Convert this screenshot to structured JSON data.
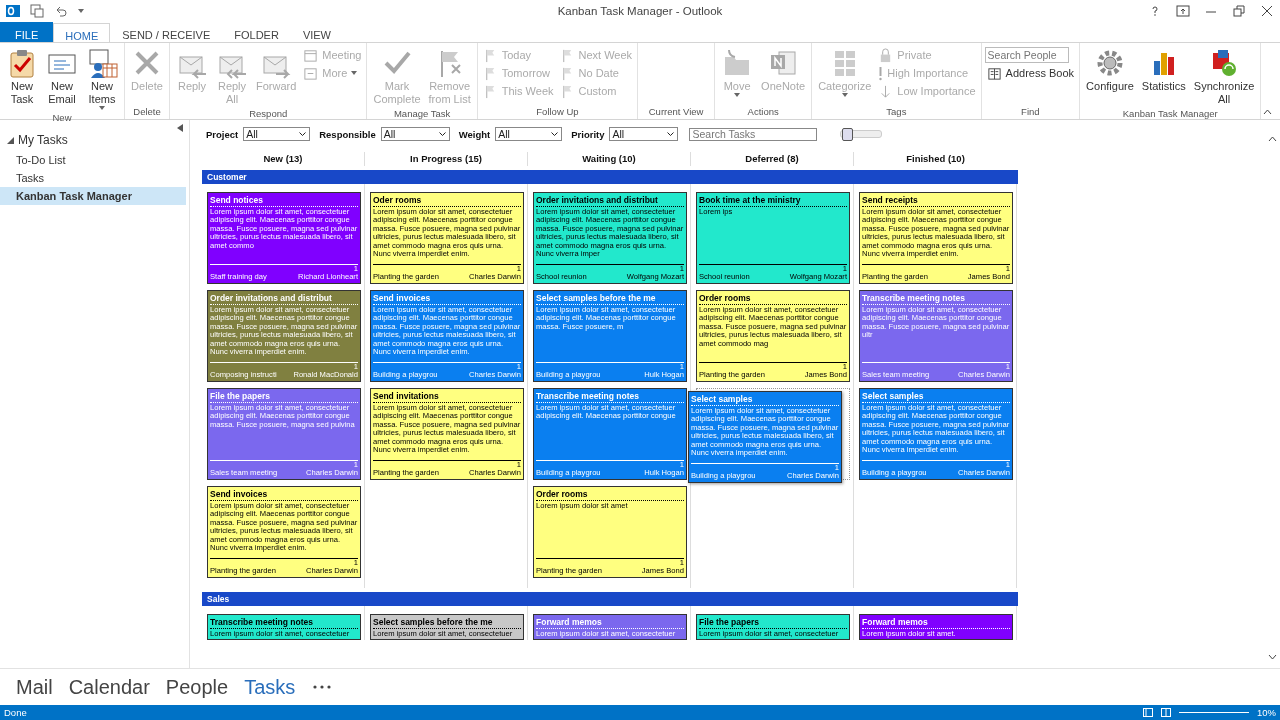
{
  "window": {
    "title": "Kanban Task Manager - Outlook"
  },
  "tabs": [
    {
      "label": "FILE",
      "kind": "file",
      "selected": false
    },
    {
      "label": "HOME",
      "kind": "tab",
      "selected": true
    },
    {
      "label": "SEND / RECEIVE",
      "kind": "tab",
      "selected": false
    },
    {
      "label": "FOLDER",
      "kind": "tab",
      "selected": false
    },
    {
      "label": "VIEW",
      "kind": "tab",
      "selected": false
    }
  ],
  "ribbon": [
    {
      "name": "New",
      "items": [
        {
          "label": "New\nTask",
          "kind": "large",
          "disabled": false
        },
        {
          "label": "New\nEmail",
          "kind": "large",
          "disabled": false
        },
        {
          "label": "New\nItems",
          "kind": "large",
          "disabled": false,
          "dropdown": true
        }
      ]
    },
    {
      "name": "Delete",
      "items": [
        {
          "label": "Delete",
          "kind": "large",
          "disabled": true
        }
      ]
    },
    {
      "name": "Respond",
      "items": [
        {
          "label": "Reply",
          "kind": "large",
          "disabled": true
        },
        {
          "label": "Reply\nAll",
          "kind": "large",
          "disabled": true
        },
        {
          "label": "Forward",
          "kind": "large",
          "disabled": true
        },
        {
          "label": "Meeting",
          "kind": "small",
          "disabled": true
        },
        {
          "label": "More",
          "kind": "small",
          "disabled": true,
          "dropdown": true
        }
      ]
    },
    {
      "name": "Manage Task",
      "items": [
        {
          "label": "Mark\nComplete",
          "kind": "large",
          "disabled": true
        },
        {
          "label": "Remove\nfrom List",
          "kind": "large",
          "disabled": true
        }
      ]
    },
    {
      "name": "Follow Up",
      "items": [
        {
          "label": "Today",
          "kind": "small",
          "disabled": true
        },
        {
          "label": "Tomorrow",
          "kind": "small",
          "disabled": true
        },
        {
          "label": "This Week",
          "kind": "small",
          "disabled": true
        },
        {
          "label": "Next Week",
          "kind": "small",
          "disabled": true
        },
        {
          "label": "No Date",
          "kind": "small",
          "disabled": true
        },
        {
          "label": "Custom",
          "kind": "small",
          "disabled": true
        }
      ]
    },
    {
      "name": "Current View"
    },
    {
      "name": "Actions",
      "items": [
        {
          "label": "Move",
          "kind": "large",
          "disabled": true,
          "dropdown": true
        },
        {
          "label": "OneNote",
          "kind": "large",
          "disabled": true
        }
      ]
    },
    {
      "name": "Tags",
      "items": [
        {
          "label": "Categorize",
          "kind": "large",
          "disabled": true,
          "dropdown": true
        },
        {
          "label": "Private",
          "kind": "small",
          "disabled": true
        },
        {
          "label": "High Importance",
          "kind": "small",
          "disabled": true
        },
        {
          "label": "Low Importance",
          "kind": "small",
          "disabled": true
        }
      ]
    },
    {
      "name": "Find",
      "items": [
        {
          "placeholder": "Search People",
          "kind": "field"
        },
        {
          "label": "Address Book",
          "kind": "small",
          "disabled": false
        }
      ]
    },
    {
      "name": "Kanban Task Manager",
      "items": [
        {
          "label": "Configure",
          "kind": "large",
          "disabled": false
        },
        {
          "label": "Statistics",
          "kind": "large",
          "disabled": false
        },
        {
          "label": "Synchronize\nAll",
          "kind": "large",
          "disabled": false
        }
      ]
    }
  ],
  "sidebar": {
    "header": "My Tasks",
    "expanded": true,
    "items": [
      {
        "label": "To-Do List",
        "selected": false
      },
      {
        "label": "Tasks",
        "selected": false
      },
      {
        "label": "Kanban Task Manager",
        "selected": true
      }
    ]
  },
  "filters": [
    {
      "label": "Project",
      "value": "All"
    },
    {
      "label": "Responsible",
      "value": "All"
    },
    {
      "label": "Weight",
      "value": "All"
    },
    {
      "label": "Priority",
      "value": "All"
    }
  ],
  "search": {
    "placeholder": "Search Tasks"
  },
  "zoom_slider": {
    "level": 0.15
  },
  "columns": [
    "New (13)",
    "In Progress (15)",
    "Waiting (10)",
    "Deferred (8)",
    "Finished (10)"
  ],
  "lanes": [
    {
      "name": "Customer",
      "columns": [
        [
          {
            "title": "Send notices",
            "body": "Lorem ipsum dolor sit amet, consectetuer adipiscing elit. Maecenas porttitor congue massa. Fusce posuere, magna sed pulvinar ultricies, purus lectus malesuada libero, sit amet commo",
            "number": "1",
            "project": "Staff training day",
            "person": "Richard Lionheart",
            "color": "#8000ff"
          },
          {
            "title": "Order invitations and distribut",
            "body": "Lorem ipsum dolor sit amet, consectetuer adipiscing elit. Maecenas porttitor congue massa. Fusce posuere, magna sed pulvinar ultricies, purus lectus malesuada libero, sit amet commodo magna eros quis urna. Nunc viverra imperdiet enim.",
            "number": "1",
            "project": "Composing instructi",
            "person": "Ronald MacDonald",
            "color": "#808040"
          },
          {
            "title": "File the papers",
            "body": "Lorem ipsum dolor sit amet, consectetuer adipiscing elit. Maecenas porttitor congue massa. Fusce posuere, magna sed pulvina",
            "number": "1",
            "project": "Sales team meeting",
            "person": "Charles Darwin",
            "color": "#7b68ee"
          },
          {
            "title": "Send invoices",
            "body": "Lorem ipsum dolor sit amet, consectetuer adipiscing elit. Maecenas porttitor congue massa. Fusce posuere, magna sed pulvinar ultricies, purus lectus malesuada libero, sit amet commodo magna eros quis urna. Nunc viverra imperdiet enim.",
            "number": "1",
            "project": "Planting the garden",
            "person": "Charles Darwin",
            "color": "#ffff80"
          }
        ],
        [
          {
            "title": "Oder rooms",
            "body": "Lorem ipsum dolor sit amet, consectetuer adipiscing elit. Maecenas porttitor congue massa. Fusce posuere, magna sed pulvinar ultricies, purus lectus malesuada libero, sit amet commodo magna eros quis urna. Nunc viverra imperdiet enim.",
            "number": "1",
            "project": "Planting the garden",
            "person": "Charles Darwin",
            "color": "#ffff80"
          },
          {
            "title": "Send invoices",
            "body": "Lorem ipsum dolor sit amet, consectetuer adipiscing elit. Maecenas porttitor congue massa. Fusce posuere, magna sed pulvinar ultricies, purus lectus malesuada libero, sit amet commodo magna eros quis urna. Nunc viverra imperdiet enim.",
            "number": "1",
            "project": "Building a playgrou",
            "person": "Charles Darwin",
            "color": "#0a7ff0"
          },
          {
            "title": "Send invitations",
            "body": "Lorem ipsum dolor sit amet, consectetuer adipiscing elit. Maecenas porttitor congue massa. Fusce posuere, magna sed pulvinar ultricies, purus lectus malesuada libero, sit amet commodo magna eros quis urna. Nunc viverra imperdiet enim.",
            "number": "1",
            "project": "Planting the garden",
            "person": "Charles Darwin",
            "color": "#ffff80"
          }
        ],
        [
          {
            "title": "Order invitations and distribut",
            "body": "Lorem ipsum dolor sit amet, consectetuer adipiscing elit. Maecenas porttitor congue massa. Fusce posuere, magna sed pulvinar ultricies, purus lectus malesuada libero, sit amet commodo magna eros quis urna. Nunc viverra imper",
            "number": "1",
            "project": "School reunion",
            "person": "Wolfgang Mozart",
            "color": "#22e8cc"
          },
          {
            "title": "Select samples before the me",
            "body": "Lorem ipsum dolor sit amet, consectetuer adipiscing elit. Maecenas porttitor congue massa. Fusce posuere, m",
            "number": "1",
            "project": "Building a playgrou",
            "person": "Hulk Hogan",
            "color": "#0a7ff0"
          },
          {
            "title": "Transcribe meeting notes",
            "body": "Lorem ipsum dolor sit amet, consectetuer adipiscing elit. Maecenas porttitor congue",
            "number": "1",
            "project": "Building a playgrou",
            "person": "Hulk Hogan",
            "color": "#0a7ff0"
          },
          {
            "title": "Order rooms",
            "body": "Lorem ipsum dolor sit amet",
            "number": "1",
            "project": "Planting the garden",
            "person": "James Bond",
            "color": "#ffff80"
          }
        ],
        [
          {
            "title": "Book time at the ministry",
            "body": "Lorem ips",
            "number": "1",
            "project": "School reunion",
            "person": "Wolfgang Mozart",
            "color": "#22e8cc"
          },
          {
            "title": "Order rooms",
            "body": "Lorem ipsum dolor sit amet, consectetuer adipiscing elit. Maecenas porttitor congue massa. Fusce posuere, magna sed pulvinar ultricies, purus lectus malesuada libero, sit amet commodo mag",
            "number": "1",
            "project": "Planting the garden",
            "person": "James Bond",
            "color": "#ffff80"
          },
          {
            "title": "Select samples",
            "body": "Lorem ipsum dolor sit amet, consectetuer adipiscing elit. Maecenas porttitor congue massa. Fusce posuere, magna sed pulvinar ultricies, purus lectus malesuada libero, sit amet commodo magna eros quis urna. Nunc viverra imperdiet enim.",
            "number": "1",
            "project": "Building a playgrou",
            "person": "Charles Darwin",
            "color": "#0a7ff0",
            "dragging": true
          }
        ],
        [
          {
            "title": "Send receipts",
            "body": "Lorem ipsum dolor sit amet, consectetuer adipiscing elit. Maecenas porttitor congue massa. Fusce posuere, magna sed pulvinar ultricies, purus lectus malesuada libero, sit amet commodo magna eros quis urna. Nunc viverra imperdiet enim.",
            "number": "1",
            "project": "Planting the garden",
            "person": "James Bond",
            "color": "#ffff80"
          },
          {
            "title": "Transcribe meeting notes",
            "body": "Lorem ipsum dolor sit amet, consectetuer adipiscing elit. Maecenas porttitor congue massa. Fusce posuere, magna sed pulvinar ultr",
            "number": "1",
            "project": "Sales team meeting",
            "person": "Charles Darwin",
            "color": "#7b68ee"
          },
          {
            "title": "Select samples",
            "body": "Lorem ipsum dolor sit amet, consectetuer adipiscing elit. Maecenas porttitor congue massa. Fusce posuere, magna sed pulvinar ultricies, purus lectus malesuada libero, sit amet commodo magna eros quis urna. Nunc viverra imperdiet enim.",
            "number": "1",
            "project": "Building a playgrou",
            "person": "Charles Darwin",
            "color": "#0a7ff0"
          }
        ]
      ]
    },
    {
      "name": "Sales",
      "columns": [
        [
          {
            "title": "Transcribe meeting notes",
            "body": "Lorem ipsum dolor sit amet, consectetuer",
            "color": "#22e8cc"
          }
        ],
        [
          {
            "title": "Select samples before the me",
            "body": "Lorem ipsum dolor sit amet, consectetuer",
            "color": "#c8c8c8"
          }
        ],
        [
          {
            "title": "Forward memos",
            "body": "Lorem ipsum dolor sit amet, consectetuer",
            "color": "#7b68ee"
          }
        ],
        [
          {
            "title": "File the papers",
            "body": "Lorem ipsum dolor sit amet, consectetuer",
            "color": "#22e8cc"
          }
        ],
        [
          {
            "title": "Forward memos",
            "body": "Lorem ipsum dolor sit amet.",
            "color": "#8000ff"
          }
        ]
      ]
    }
  ],
  "nav": [
    {
      "label": "Mail",
      "selected": false
    },
    {
      "label": "Calendar",
      "selected": false
    },
    {
      "label": "People",
      "selected": false
    },
    {
      "label": "Tasks",
      "selected": true
    }
  ],
  "status_bar": {
    "text": "Done",
    "zoom": "10%"
  }
}
